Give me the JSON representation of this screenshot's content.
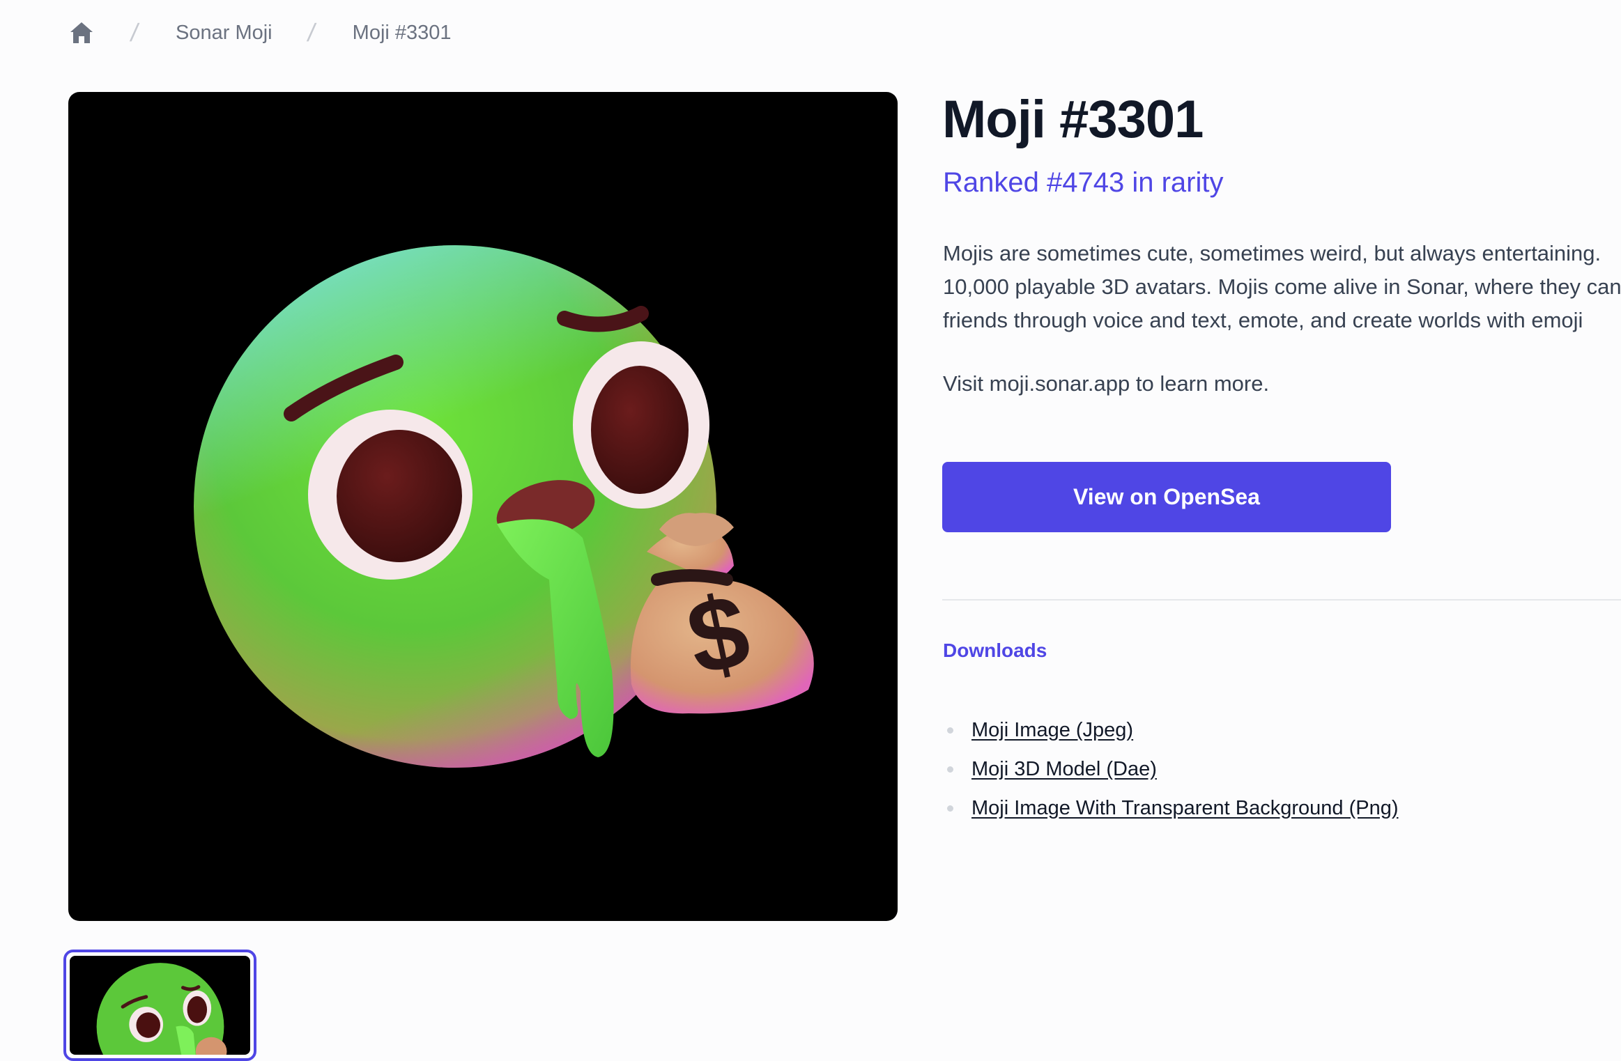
{
  "breadcrumb": {
    "home_icon": "home-icon",
    "items": [
      {
        "label": "Sonar Moji"
      },
      {
        "label": "Moji #3301"
      }
    ],
    "separator": "/"
  },
  "gallery": {
    "main_image_alt": "Green 3D emoji with money bag",
    "thumbnail_count": 1,
    "selected_thumbnail": 0
  },
  "product": {
    "title": "Moji #3301",
    "rank_text": "Ranked #4743 in rarity",
    "description_lines": [
      "Mojis are sometimes cute, sometimes weird, but always entertaining.",
      "10,000 playable 3D avatars. Mojis come alive in Sonar, where they can",
      "friends through voice and text, emote, and create worlds with emoji"
    ],
    "visit_text": "Visit moji.sonar.app to learn more.",
    "cta_label": "View on OpenSea"
  },
  "downloads": {
    "heading": "Downloads",
    "items": [
      {
        "label": "Moji Image (Jpeg)"
      },
      {
        "label": "Moji 3D Model (Dae)"
      },
      {
        "label": "Moji Image With Transparent Background (Png)"
      }
    ]
  },
  "colors": {
    "accent": "#4f46e5",
    "title": "#111827",
    "body_text": "#374151",
    "muted": "#6b7280",
    "image_background": "#000000"
  }
}
